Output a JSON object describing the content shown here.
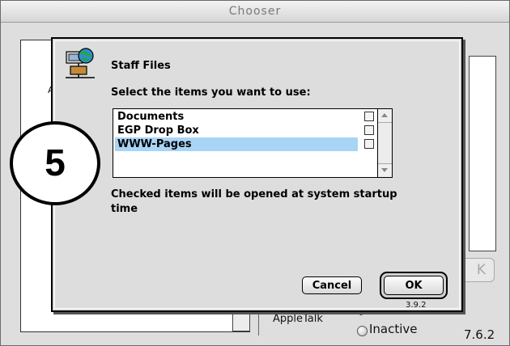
{
  "chooser": {
    "title": "Chooser",
    "ok_label": "K",
    "appletalk_label": "AppleTalk",
    "inactive_label": "Inactive",
    "version": "7.6.2",
    "left_pane_char": "A"
  },
  "dialog": {
    "title": "Staff Files",
    "prompt": "Select the items you want to use:",
    "items": [
      {
        "label": "Documents",
        "checked": false,
        "selected": false
      },
      {
        "label": "EGP Drop Box",
        "checked": false,
        "selected": false
      },
      {
        "label": "WWW-Pages",
        "checked": false,
        "selected": true
      }
    ],
    "note": "Checked items will be opened at system startup time",
    "cancel_label": "Cancel",
    "ok_label": "OK",
    "version": "3.9.2",
    "icon": "network-volume-icon"
  },
  "step": {
    "number": "5"
  },
  "colors": {
    "selection": "#a8d4f6",
    "window_bg": "#dddddd"
  }
}
